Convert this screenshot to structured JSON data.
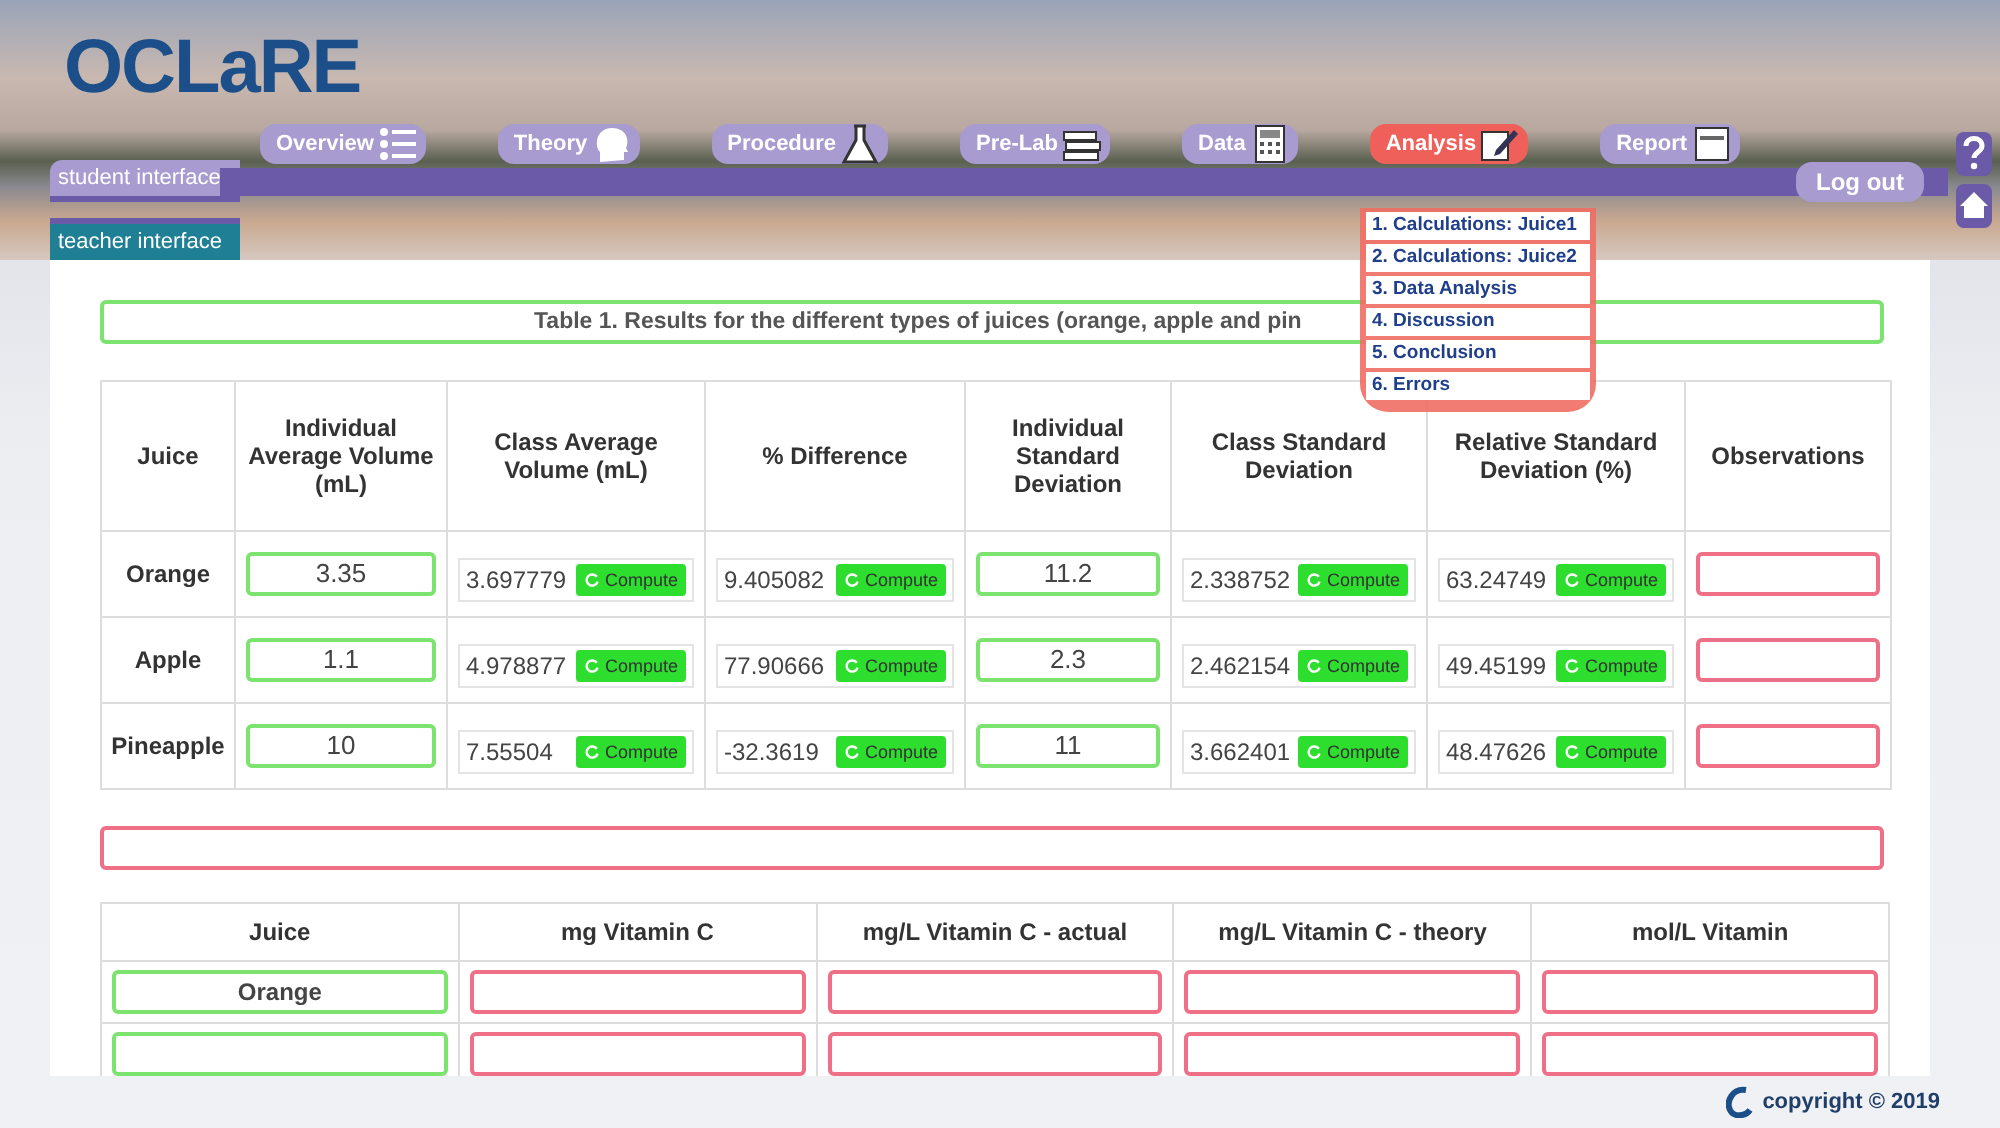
{
  "logo": "OCLaRE",
  "interfaces": [
    {
      "label": "student interface",
      "selected": true
    },
    {
      "label": "teacher interface",
      "selected": false
    }
  ],
  "tabs": [
    {
      "label": "Overview",
      "selected": false
    },
    {
      "label": "Theory",
      "selected": false
    },
    {
      "label": "Procedure",
      "selected": false
    },
    {
      "label": "Pre-Lab",
      "selected": false
    },
    {
      "label": "Data",
      "selected": false
    },
    {
      "label": "Analysis",
      "selected": true
    },
    {
      "label": "Report",
      "selected": false
    }
  ],
  "logout_button": "Log out",
  "analysis_menu": [
    "1. Calculations: Juice1",
    "2. Calculations: Juice2",
    "3. Data Analysis",
    "4. Discussion",
    "5. Conclusion",
    "6. Errors"
  ],
  "table1": {
    "caption": "Table 1. Results for the different types of juices (orange, apple and pin",
    "columns": [
      "Juice",
      "Individual Average Volume (mL)",
      "Class Average Volume (mL)",
      "% Difference",
      "Individual Standard Deviation",
      "Class Standard Deviation",
      "Relative Standard Deviation (%)",
      "Observations"
    ],
    "rows": [
      {
        "cells": [
          {
            "kind": "label",
            "value": "Orange"
          },
          {
            "kind": "input",
            "value": "3.35"
          },
          {
            "kind": "computed",
            "value": "3.697779",
            "button": "Compute"
          },
          {
            "kind": "computed",
            "value": "9.405082",
            "button": "Compute"
          },
          {
            "kind": "input",
            "value": "11.2"
          },
          {
            "kind": "computed",
            "value": "2.338752",
            "button": "Compute"
          },
          {
            "kind": "computed",
            "value": "63.24749",
            "button": "Compute"
          },
          {
            "kind": "blank"
          }
        ]
      },
      {
        "cells": [
          {
            "kind": "label",
            "value": "Apple"
          },
          {
            "kind": "input",
            "value": "1.1"
          },
          {
            "kind": "computed",
            "value": "4.978877",
            "button": "Compute"
          },
          {
            "kind": "computed",
            "value": "77.90666",
            "button": "Compute"
          },
          {
            "kind": "input",
            "value": "2.3"
          },
          {
            "kind": "computed",
            "value": "2.462154",
            "button": "Compute"
          },
          {
            "kind": "computed",
            "value": "49.45199",
            "button": "Compute"
          },
          {
            "kind": "blank"
          }
        ]
      },
      {
        "cells": [
          {
            "kind": "label",
            "value": "Pineapple"
          },
          {
            "kind": "input",
            "value": "10"
          },
          {
            "kind": "computed",
            "value": "7.55504",
            "button": "Compute"
          },
          {
            "kind": "computed",
            "value": "-32.3619",
            "button": "Compute"
          },
          {
            "kind": "input",
            "value": "11"
          },
          {
            "kind": "computed",
            "value": "3.662401",
            "button": "Compute"
          },
          {
            "kind": "computed",
            "value": "48.47626",
            "button": "Compute"
          },
          {
            "kind": "blank"
          }
        ]
      }
    ]
  },
  "table2": {
    "columns": [
      "Juice",
      "mg Vitamin C",
      "mg/L Vitamin C - actual",
      "mg/L Vitamin C - theory",
      "mol/L Vitamin"
    ],
    "rows": [
      {
        "cells": [
          {
            "kind": "input",
            "value": "Orange"
          },
          {
            "kind": "blank"
          },
          {
            "kind": "blank"
          },
          {
            "kind": "blank"
          },
          {
            "kind": "blank"
          }
        ]
      },
      {
        "cells": [
          {
            "kind": "input"
          },
          {
            "kind": "blank"
          },
          {
            "kind": "blank"
          },
          {
            "kind": "blank"
          },
          {
            "kind": "blank"
          }
        ]
      }
    ]
  },
  "footer": {
    "copyright": "copyright © 2019"
  }
}
